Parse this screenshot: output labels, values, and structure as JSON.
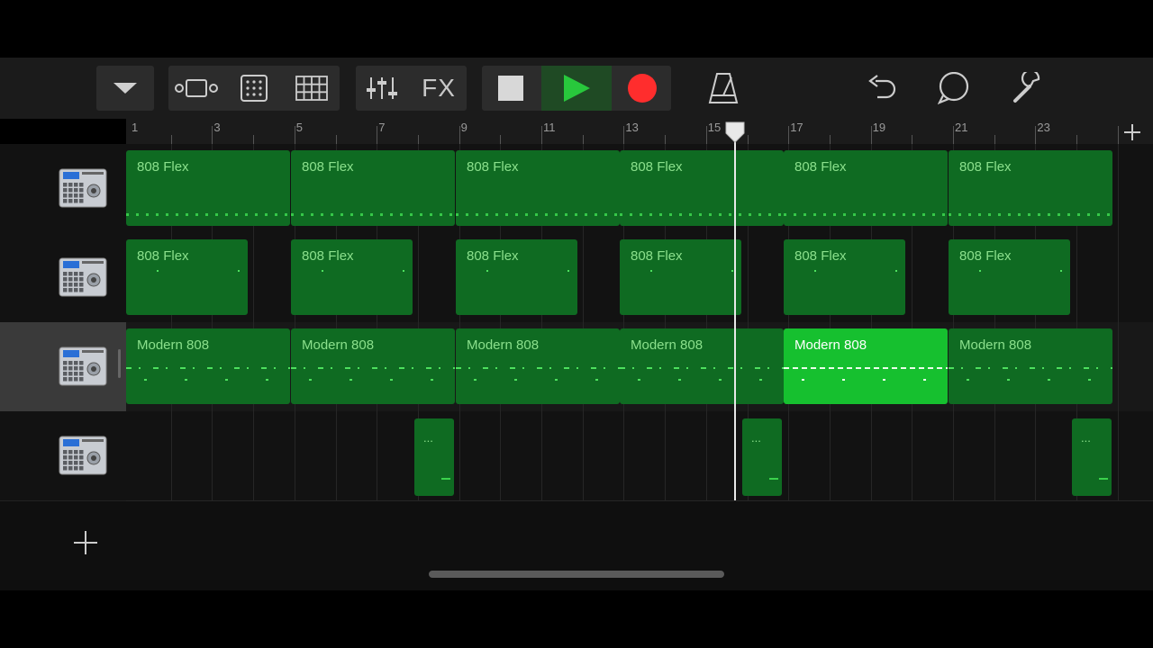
{
  "toolbar": {
    "fx_label": "FX",
    "colors": {
      "play": "#28c83c",
      "record": "#ff2d2d",
      "stop": "#d8d8d8"
    }
  },
  "ruler": {
    "bar_numbers": [
      "1",
      "3",
      "5",
      "7",
      "9",
      "11",
      "13",
      "15",
      "17",
      "19",
      "21",
      "23"
    ]
  },
  "tracks": [
    {
      "instrument": "drum-machine-icon",
      "selected": false,
      "regions": [
        "808 Flex",
        "808 Flex",
        "808 Flex",
        "808 Flex",
        "808 Flex",
        "808 Flex"
      ]
    },
    {
      "instrument": "drum-machine-icon",
      "selected": false,
      "regions": [
        "808 Flex",
        "808 Flex",
        "808 Flex",
        "808 Flex",
        "808 Flex",
        "808 Flex"
      ]
    },
    {
      "instrument": "drum-machine-icon",
      "selected": true,
      "regions": [
        "Modern 808",
        "Modern 808",
        "Modern 808",
        "Modern 808",
        "Modern 808",
        "Modern 808"
      ],
      "highlighted_region": 4
    },
    {
      "instrument": "drum-machine-icon",
      "selected": false,
      "regions": [
        "...",
        "...",
        "..."
      ]
    }
  ],
  "accent_color": "#16c02f",
  "region_color": "#0f6b22"
}
